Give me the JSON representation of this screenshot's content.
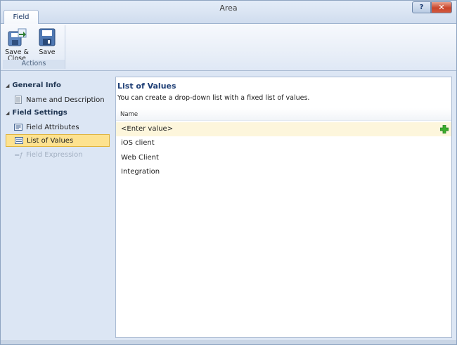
{
  "window": {
    "title": "Area",
    "help_label": "?",
    "close_label": "✕"
  },
  "ribbon": {
    "tab_label": "Field",
    "group_label": "Actions",
    "save_close_label": "Save & Close",
    "save_label": "Save"
  },
  "sidebar": {
    "general_info": "General Info",
    "name_description": "Name and Description",
    "field_settings": "Field Settings",
    "field_attributes": "Field Attributes",
    "list_of_values": "List of Values",
    "field_expression": "Field Expression"
  },
  "main": {
    "title": "List of Values",
    "description": "You can create a drop-down list with a fixed list of values.",
    "column_header": "Name",
    "rows": [
      "<Enter value>",
      "iOS client",
      "Web Client",
      "Integration"
    ]
  },
  "colors": {
    "accent": "#1f3f76",
    "selection": "#fde28f",
    "add": "#3cae2c"
  }
}
